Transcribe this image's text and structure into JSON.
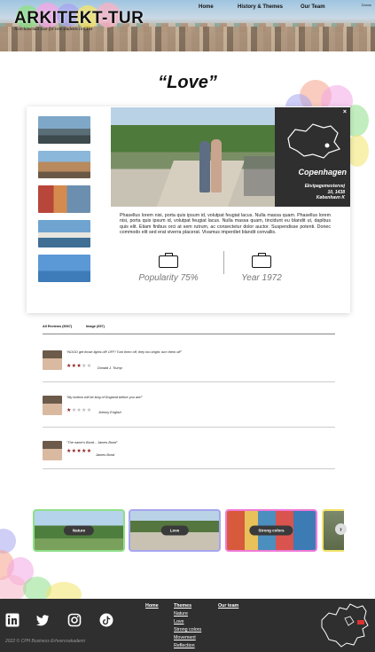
{
  "header": {
    "logo": "ARKITEKT-TUR",
    "tagline": "A architectual tour for new students in CPH",
    "nav": {
      "home": "Home",
      "history": "History & Themes",
      "team": "Our Team"
    },
    "language": "Dansk"
  },
  "page": {
    "title": "“Love”"
  },
  "card": {
    "city": "Copenhagen",
    "address_line1": "Ekvipagemestervej",
    "address_line2": "10, 1438",
    "address_line3": "København K",
    "close_label": "×",
    "description": "Phasellus lorem nisi, porta quis ipsum id, volutpat feugiat lacus. Nulla massa quam. Phasellus lorem nisi, porta quis ipsum id, volutpat feugiat lacus. Nulla massa quam, tincidunt eu blandit ut, dapibus quis elit. Etiam finibus orci at sem rutrum, ac consectetur dolor auctor. Suspendisse potenti. Donec commodo elit sed erat viverra placerat. Vivamus imperdiet blandit convallis.",
    "popularity": "Popularity 75%",
    "year": "Year 1972"
  },
  "reviews": {
    "tab_all": "All Reviews (5067)",
    "tab_image": "Image (657)",
    "items": [
      {
        "text": "“NOOO get those lights off! OFF! Turn them off, they too bright, turn them off”",
        "name": "Donald J. Trump",
        "stars_filled": "★★★",
        "stars_empty": "★★"
      },
      {
        "text": "“My bottom will be king of England before you are!”",
        "name": "Johnny English",
        "stars_filled": "★",
        "stars_empty": "★★★★"
      },
      {
        "text": "“The name's Bond... James Bond”",
        "name": "James Bond",
        "stars_filled": "★★★★★",
        "stars_empty": ""
      }
    ]
  },
  "themes": {
    "items": [
      "Nature",
      "Love",
      "Strong colors"
    ],
    "next_label": "›"
  },
  "footer": {
    "col1": {
      "head": "Home"
    },
    "col2": {
      "head": "Themes",
      "items": [
        "Nature",
        "Love",
        "Strong colors",
        "Movement",
        "Reflection"
      ]
    },
    "col3": {
      "head": "Our team"
    },
    "copyright": "2022 © CPH Business Erhvervsakademi",
    "social_icons": [
      "linkedin-icon",
      "twitter-icon",
      "instagram-icon",
      "tiktok-icon"
    ]
  }
}
